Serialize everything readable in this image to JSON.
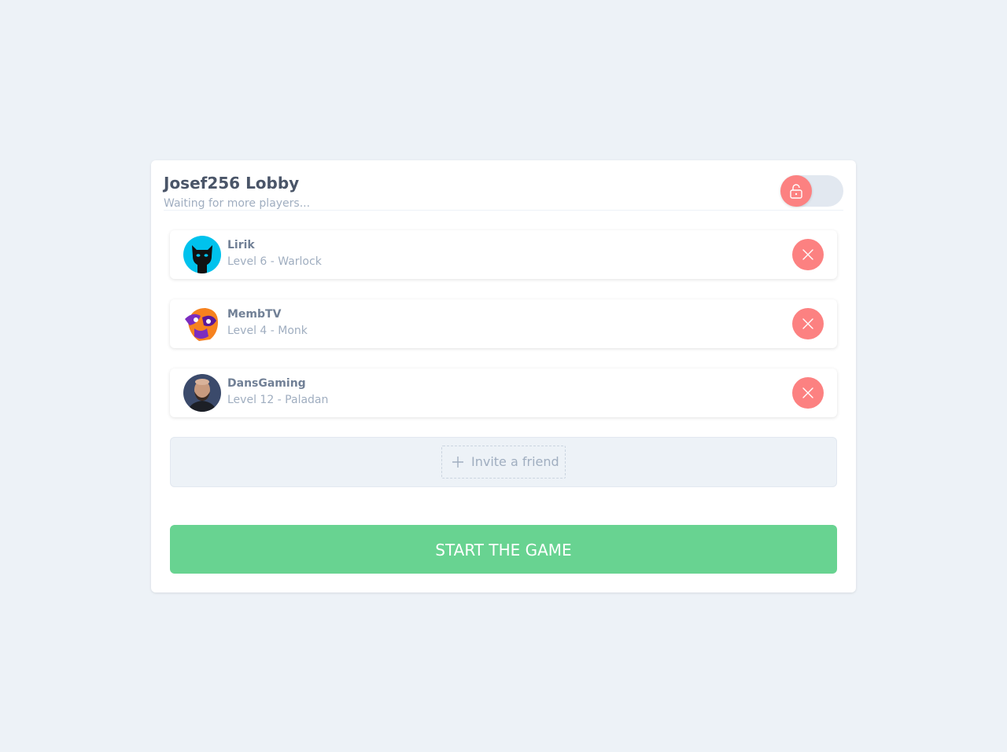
{
  "lobby": {
    "title": "Josef256 Lobby",
    "subtitle": "Waiting for more players...",
    "lock_icon": "unlock-icon"
  },
  "players": [
    {
      "name": "Lirik",
      "detail": "Level 6 - Warlock",
      "avatar": "black-cat-avatar"
    },
    {
      "name": "MembTV",
      "detail": "Level 4 - Monk",
      "avatar": "purple-orange-mascot-avatar"
    },
    {
      "name": "DansGaming",
      "detail": "Level 12 - Paladan",
      "avatar": "bearded-man-photo-avatar"
    }
  ],
  "invite": {
    "label": "Invite a friend",
    "icon": "plus-icon"
  },
  "start": {
    "label": "START THE GAME"
  },
  "colors": {
    "background": "#edf2f7",
    "danger": "#fc8181",
    "success": "#68d391",
    "title": "#4a5568",
    "muted": "#a0aec0"
  }
}
